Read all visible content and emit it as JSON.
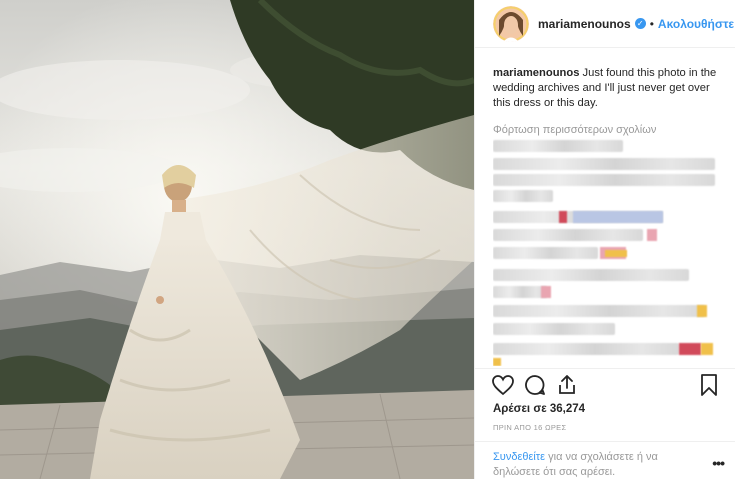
{
  "post": {
    "username": "mariamenounos",
    "verified": true,
    "separator": "•",
    "follow_label": "Ακολουθήστε",
    "caption_username": "mariamenounos",
    "caption_text": " Just found this photo in the wedding archives and I'll just never get over this dress or this day.",
    "load_more_label": "Φόρτωση περισσότερων σχολίων",
    "likes_text": "Αρέσει σε 36,274",
    "time_text": "ΠΡΙΝ ΑΠΟ 16 ΩΡΕΣ",
    "login_link": "Συνδεθείτε",
    "login_rest": " για να σχολιάσετε ή να δηλώσετε ότι σας αρέσει.",
    "more_label": "•••"
  },
  "icons": {
    "like": "heart-icon",
    "comment": "comment-bubble-icon",
    "share": "share-icon",
    "save": "bookmark-icon",
    "verified": "verified-badge-icon"
  },
  "colors": {
    "link": "#3897f0",
    "muted": "#999999",
    "text": "#262626",
    "border": "#efefef"
  }
}
